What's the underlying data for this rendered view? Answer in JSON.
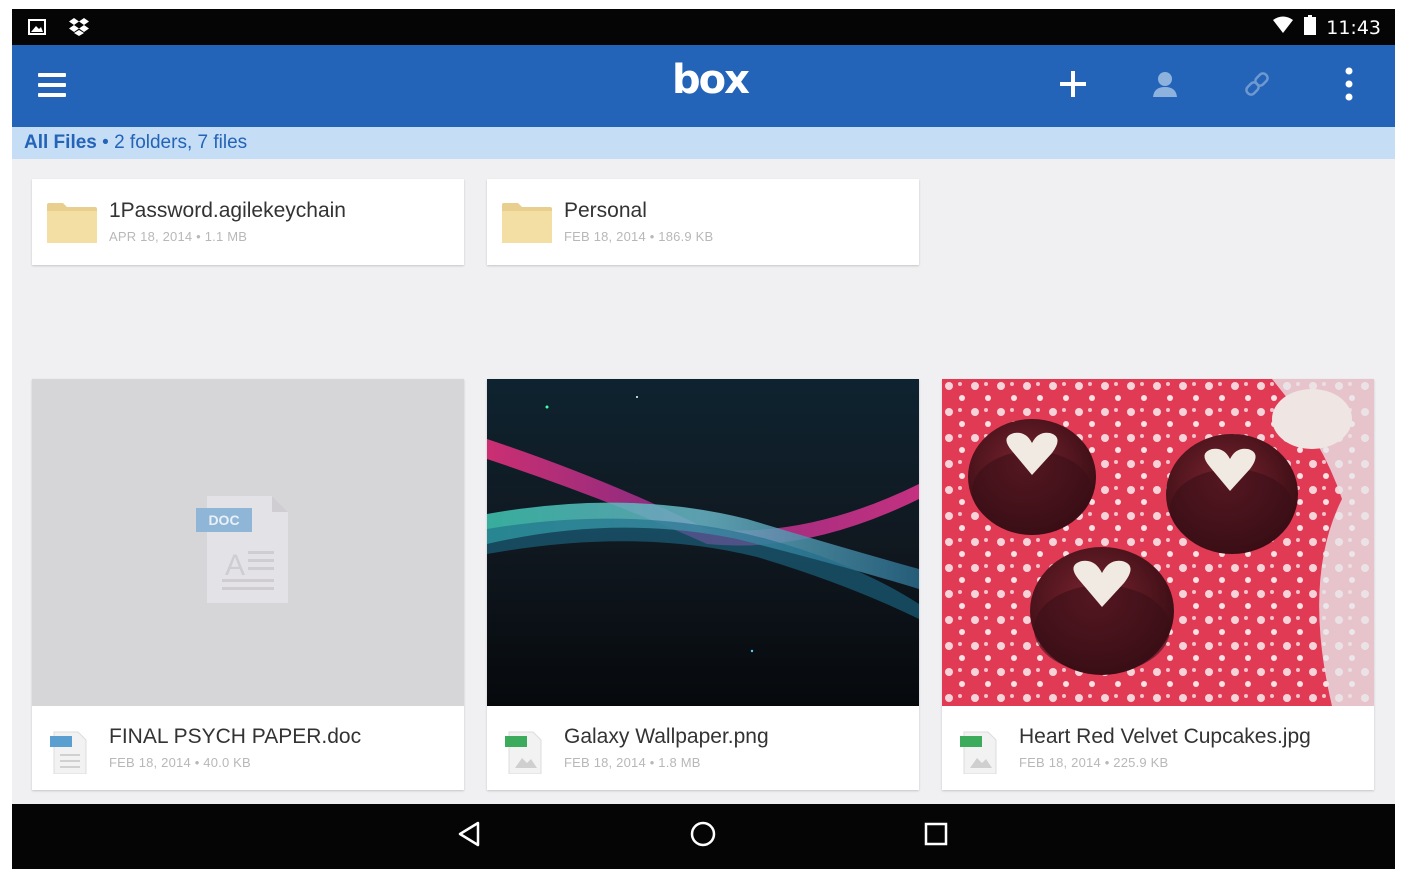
{
  "status_bar": {
    "time": "11:43",
    "left_icons": [
      "gallery-notification-icon",
      "dropbox-notification-icon"
    ],
    "right_icons": [
      "wifi-icon",
      "battery-icon"
    ]
  },
  "app_bar": {
    "logo": "box",
    "background": "#2364b9",
    "actions": [
      "add-icon",
      "person-icon",
      "link-icon",
      "overflow-menu-icon"
    ]
  },
  "breadcrumb": {
    "location": "All Files",
    "summary": " • 2 folders, 7 files"
  },
  "folders": [
    {
      "name": "1Password.agilekeychain",
      "meta": "APR 18, 2014 • 1.1 MB"
    },
    {
      "name": "Personal",
      "meta": "FEB 18, 2014 • 186.9 KB"
    }
  ],
  "files": [
    {
      "name": "FINAL PSYCH PAPER.doc",
      "meta": "FEB 18, 2014 • 40.0 KB",
      "type_badge": "DOC",
      "badge_color": "#5a9fd0"
    },
    {
      "name": "Galaxy Wallpaper.png",
      "meta": "FEB 18, 2014 • 1.8 MB",
      "type_badge": "PNG",
      "badge_color": "#3dab5c"
    },
    {
      "name": "Heart Red Velvet Cupcakes.jpg",
      "meta": "FEB 18, 2014 • 225.9 KB",
      "type_badge": "JPG",
      "badge_color": "#3dab5c"
    }
  ],
  "nav_bar": {
    "buttons": [
      "back-icon",
      "home-icon",
      "recents-icon"
    ]
  }
}
